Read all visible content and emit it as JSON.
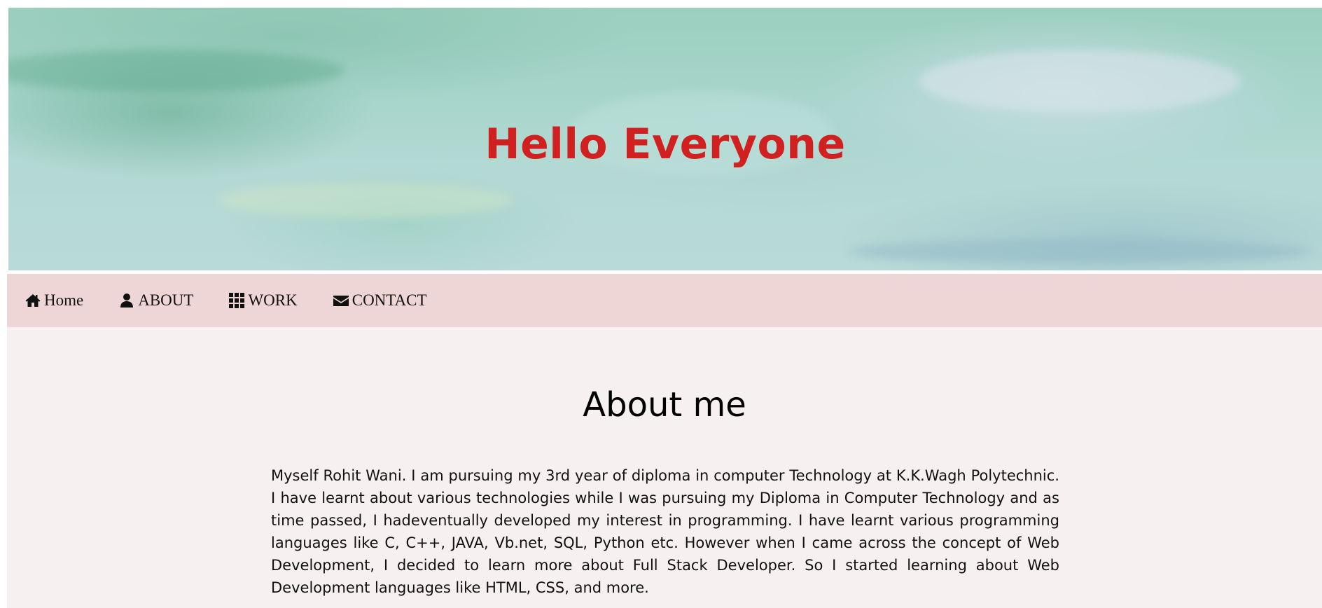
{
  "banner": {
    "title": "Hello Everyone",
    "title_color": "#d0201f"
  },
  "nav": {
    "background": "#efd6d6",
    "items": [
      {
        "label": "Home",
        "icon": "home-icon"
      },
      {
        "label": "ABOUT",
        "icon": "user-icon"
      },
      {
        "label": "WORK",
        "icon": "grid-icon"
      },
      {
        "label": "CONTACT",
        "icon": "envelope-icon"
      }
    ]
  },
  "about": {
    "heading": "About me",
    "text": "Myself Rohit Wani. I am pursuing my 3rd year of diploma in computer Technology at K.K.Wagh Polytechnic. I have learnt about various technologies while I was pursuing my Diploma in Computer Technology and as time passed, I hadeventually developed my interest in programming. I have learnt various programming languages like C, C++, JAVA, Vb.net, SQL, Python etc. However when I came across the concept of Web Development, I decided to learn more about Full Stack Developer. So I started learning about Web Development languages like HTML, CSS, and more."
  }
}
